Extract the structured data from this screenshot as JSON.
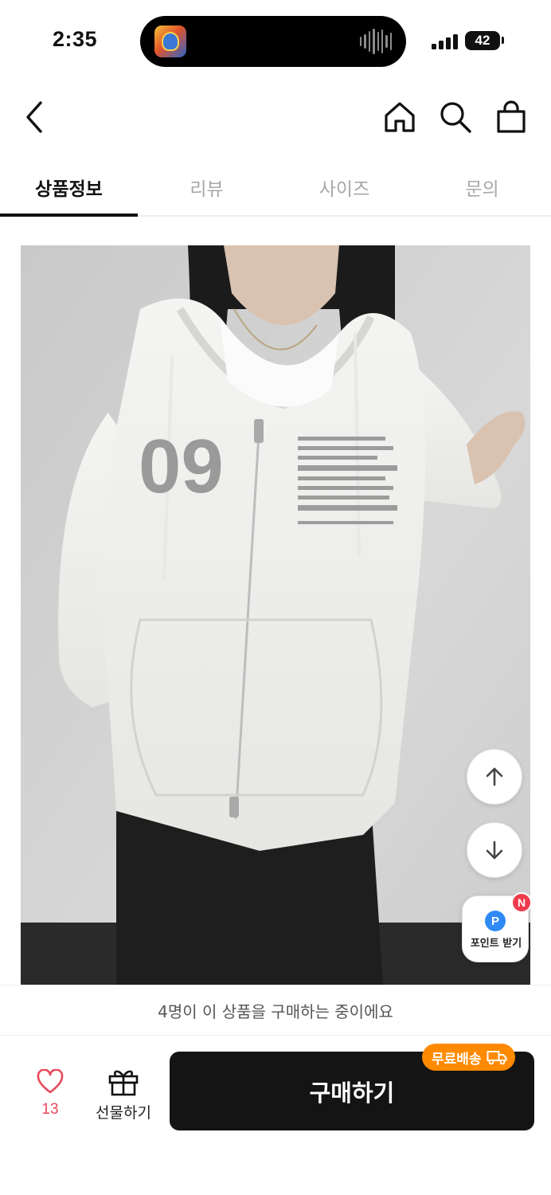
{
  "status_bar": {
    "time": "2:35",
    "battery": "42"
  },
  "header": {
    "icons": [
      "chevron-left-icon",
      "home-icon",
      "search-icon",
      "shopping-bag-icon"
    ]
  },
  "tabs": [
    {
      "label": "상품정보",
      "active": true
    },
    {
      "label": "리뷰",
      "active": false
    },
    {
      "label": "사이즈",
      "active": false
    },
    {
      "label": "문의",
      "active": false
    }
  ],
  "floating": {
    "point_icon_letter": "P",
    "point_label": "포인트 받기",
    "new_badge": "N"
  },
  "purchase_notice": "4명이 이 상품을 구매하는 중이에요",
  "bottom_bar": {
    "like_count": "13",
    "gift_label": "선물하기",
    "buy_label": "구매하기",
    "free_shipping_label": "무료배송"
  },
  "colors": {
    "accent_like": "#e8485a",
    "buy_button": "#141414",
    "free_shipping": "#ff8a00",
    "point_blue": "#2f8af5",
    "badge_red": "#ef3b4c"
  }
}
